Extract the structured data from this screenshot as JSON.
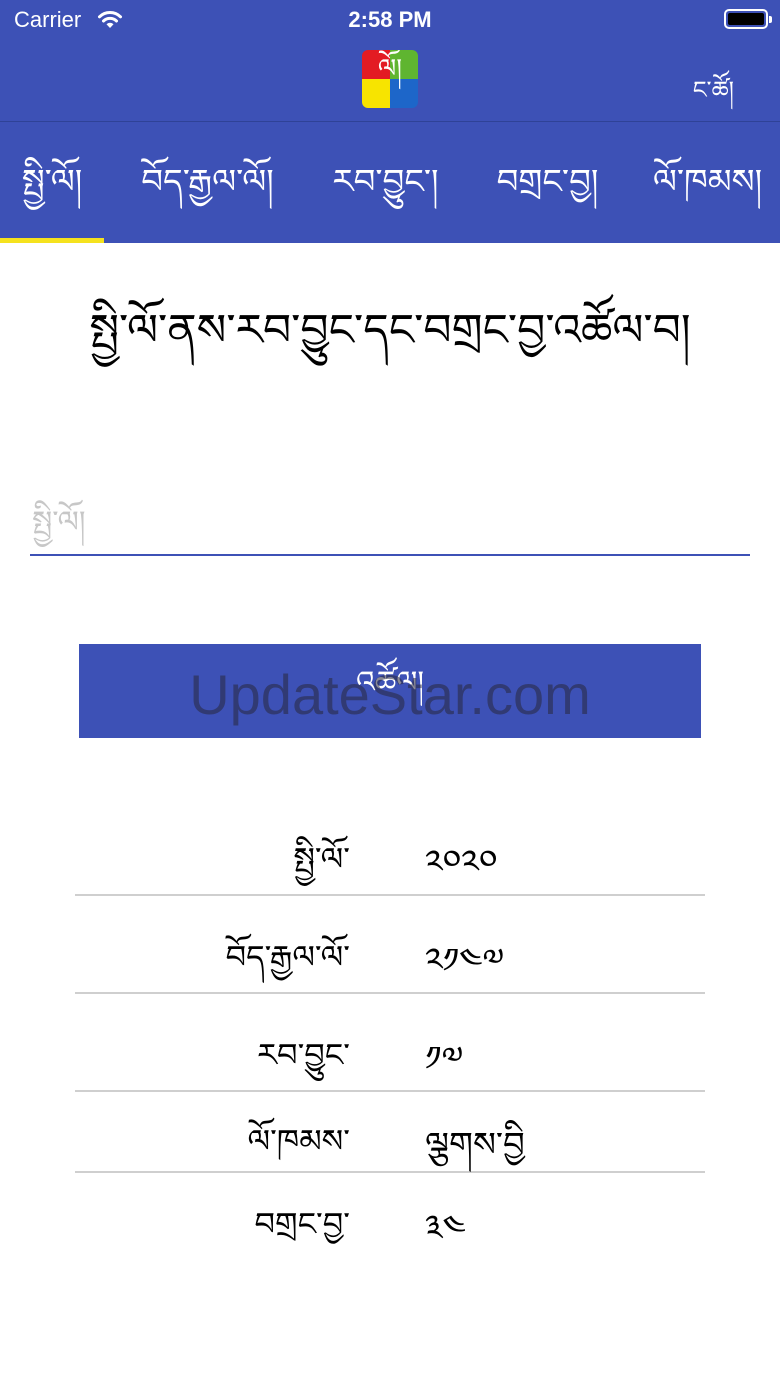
{
  "status_bar": {
    "carrier": "Carrier",
    "time": "2:58 PM"
  },
  "header": {
    "logo_text": "ལོ།",
    "action_label": "ང་ཚོ།"
  },
  "tabs": [
    {
      "label": "སྤྱི་ལོ།",
      "active": true
    },
    {
      "label": "བོད་རྒྱལ་ལོ།",
      "active": false
    },
    {
      "label": "རབ་བྱུང་།",
      "active": false
    },
    {
      "label": "བགྲང་བྱ།",
      "active": false
    },
    {
      "label": "ལོ་ཁམས།",
      "active": false
    }
  ],
  "main": {
    "title": "སྤྱི་ལོ་ནས་རབ་བྱུང་དང་བགྲང་བྱ་འཚོལ་བ།",
    "input_placeholder": "སྤྱི་ལོ།",
    "input_value": "",
    "button_label": "འཚོལ།",
    "watermark": "UpdateStar.com"
  },
  "results": [
    {
      "label": "སྤྱི་ལོ་",
      "value": "༢༠༢༠"
    },
    {
      "label": "བོད་རྒྱལ་ལོ་",
      "value": "༢༡༤༧"
    },
    {
      "label": "རབ་བྱུང་",
      "value": "༡༧"
    },
    {
      "label": "ལོ་ཁམས་",
      "value": "ལྕགས་བྱི"
    },
    {
      "label": "བགྲང་བྱ་",
      "value": "༣༤"
    }
  ],
  "colors": {
    "header_bg": "#3d51b6",
    "tab_indicator": "#f5e21e",
    "button_bg": "#3d51b6"
  }
}
